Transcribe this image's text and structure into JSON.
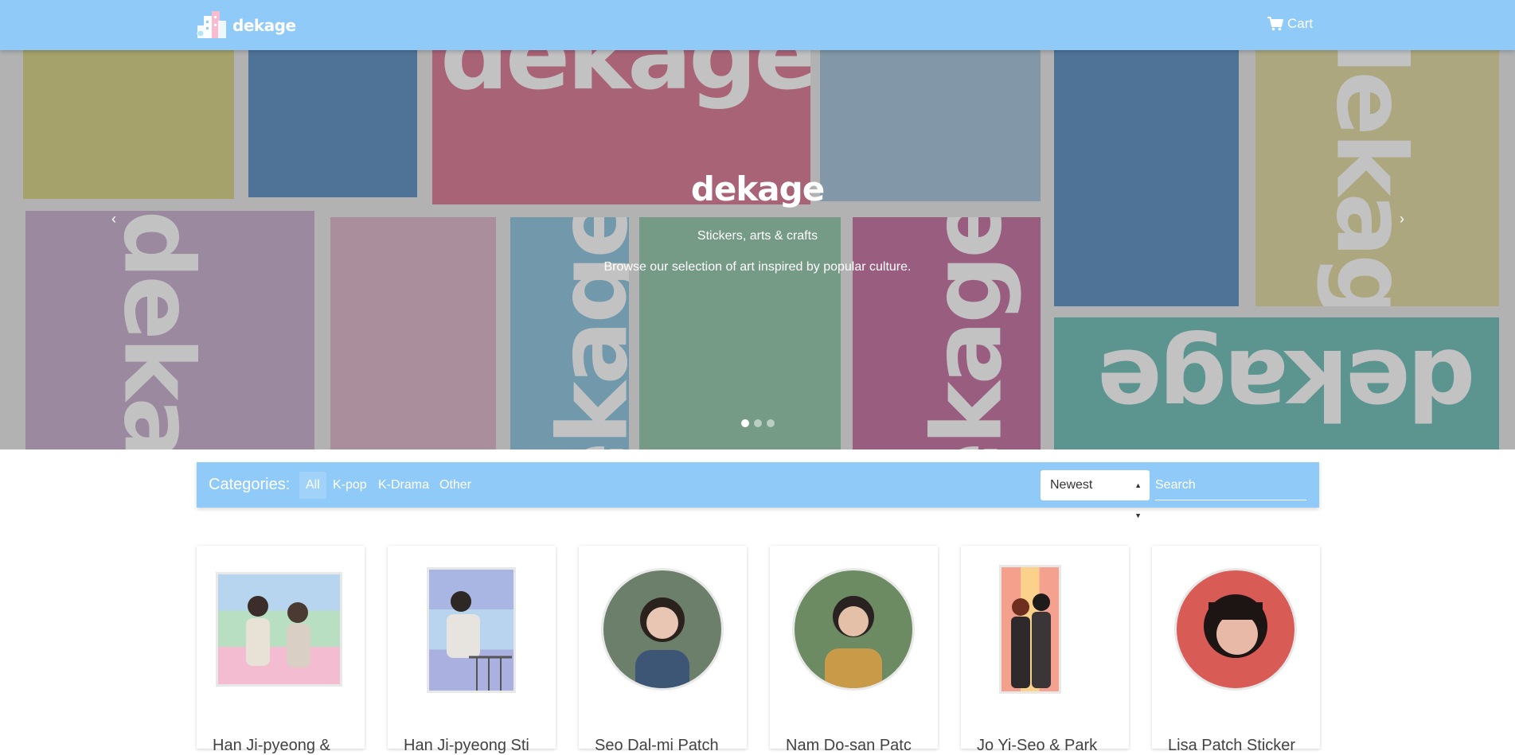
{
  "brand": {
    "name": "dekage",
    "logo_icon": "building-palette-logo"
  },
  "nav": {
    "cart_label": "Cart",
    "cart_icon": "shopping-cart-icon"
  },
  "hero": {
    "title": "dekage",
    "subtitle": "Stickers, arts & crafts",
    "description": "Browse our selection of art inspired by popular culture.",
    "watermark": "dekage",
    "prev_icon": "chevron-left-icon",
    "next_icon": "chevron-right-icon",
    "slides_count": 3,
    "active_slide": 1
  },
  "filters": {
    "label": "Categories:",
    "categories": [
      "All",
      "K-pop",
      "K-Drama",
      "Other"
    ],
    "active_category": "All",
    "sort_value": "Newest",
    "search_placeholder": "Search"
  },
  "products": [
    {
      "title": "Han Ji-pyeong & ",
      "shape": "rect"
    },
    {
      "title": "Han Ji-pyeong Sti",
      "shape": "rect"
    },
    {
      "title": "Seo Dal-mi Patch ",
      "shape": "circle"
    },
    {
      "title": "Nam Do-san Patc",
      "shape": "circle"
    },
    {
      "title": "Jo Yi-Seo & Park ",
      "shape": "rect"
    },
    {
      "title": "Lisa Patch Sticker",
      "shape": "circle"
    }
  ],
  "colors": {
    "navbar": "#90caf9",
    "hero_bg": "#b2b2b2",
    "tile_olive": "#a5a36b",
    "tile_blue": "#4f7397",
    "tile_rose": "#a96377",
    "tile_slate": "#8298a8",
    "tile_lavender": "#9a899f",
    "tile_pink": "#ab8e9c",
    "tile_teal": "#7199ab",
    "tile_green": "#759a85",
    "tile_magenta": "#985d7f",
    "tile_sand": "#ada77f",
    "tile_sea": "#5c9590"
  }
}
